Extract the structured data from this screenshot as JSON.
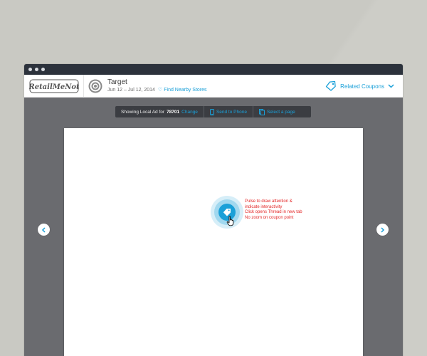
{
  "header": {
    "logo_text": "RetailMeNot",
    "store_name": "Target",
    "dates": "Jun 12 – Jul 12, 2014",
    "find_stores": "Find Nearby Stores",
    "related_coupons": "Related Coupons"
  },
  "toolbar": {
    "showing_prefix": "Showing Local Ad for",
    "zip": "78701",
    "change": "Change",
    "send_to_phone": "Send to Phone",
    "select_page": "Select a page"
  },
  "annotation": {
    "lines": [
      "Pulse to draw attention &",
      "indicate interactivity",
      "Click opens Thread in new tab",
      "No zoom on coupon point"
    ]
  },
  "colors": {
    "accent": "#1aa0d8",
    "annotation": "#e32626",
    "background": "#c9c9c3",
    "viewer": "#6a6b6f",
    "titlebar": "#2c323c"
  },
  "icons": {
    "store_logo": "target-bullseye-icon",
    "heart": "heart-icon",
    "coupon": "tag-icon",
    "chevron": "chevron-down-icon",
    "phone": "phone-icon",
    "pages": "pages-icon",
    "prev": "chevron-left-icon",
    "next": "chevron-right-icon",
    "cursor": "hand-cursor-icon"
  }
}
